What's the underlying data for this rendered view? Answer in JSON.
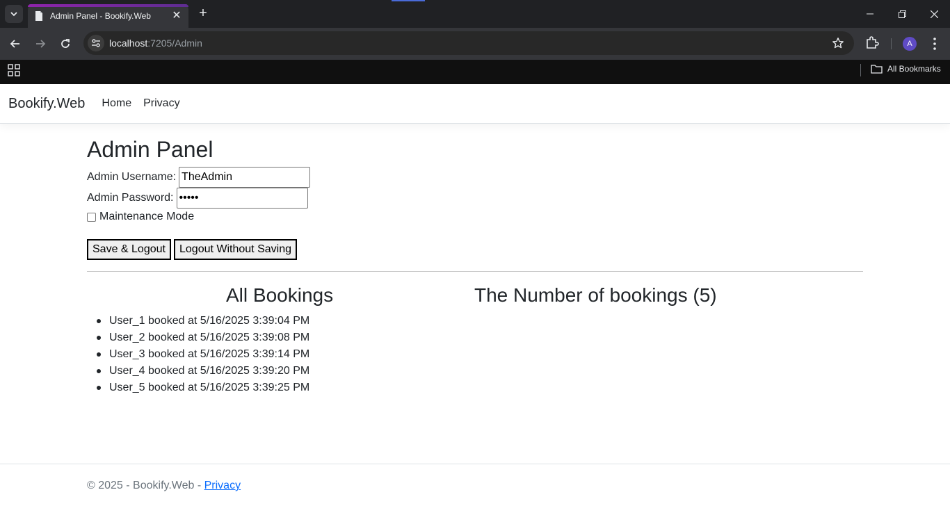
{
  "browser": {
    "tab_title": "Admin Panel - Bookify.Web",
    "url_host": "localhost",
    "url_path": ":7205/Admin",
    "all_bookmarks": "All Bookmarks",
    "profile_initial": "A"
  },
  "navbar": {
    "brand": "Bookify.Web",
    "links": [
      "Home",
      "Privacy"
    ]
  },
  "admin": {
    "title": "Admin Panel",
    "username_label": "Admin Username:",
    "username_value": "TheAdmin",
    "password_label": "Admin Password:",
    "password_value": "•••••",
    "maintenance_label": "Maintenance Mode",
    "maintenance_checked": false,
    "save_logout": "Save & Logout",
    "logout_no_save": "Logout Without Saving"
  },
  "bookings": {
    "heading": "All Bookings",
    "count_heading": "The Number of bookings (5)",
    "items": [
      "User_1 booked at 5/16/2025 3:39:04 PM",
      "User_2 booked at 5/16/2025 3:39:08 PM",
      "User_3 booked at 5/16/2025 3:39:14 PM",
      "User_4 booked at 5/16/2025 3:39:20 PM",
      "User_5 booked at 5/16/2025 3:39:25 PM"
    ]
  },
  "footer": {
    "text": "© 2025 - Bookify.Web - ",
    "link": "Privacy"
  },
  "colors": {
    "chrome_dark": "#202124",
    "link_blue": "#0d6efd",
    "tab_accent": "#8e24aa"
  }
}
